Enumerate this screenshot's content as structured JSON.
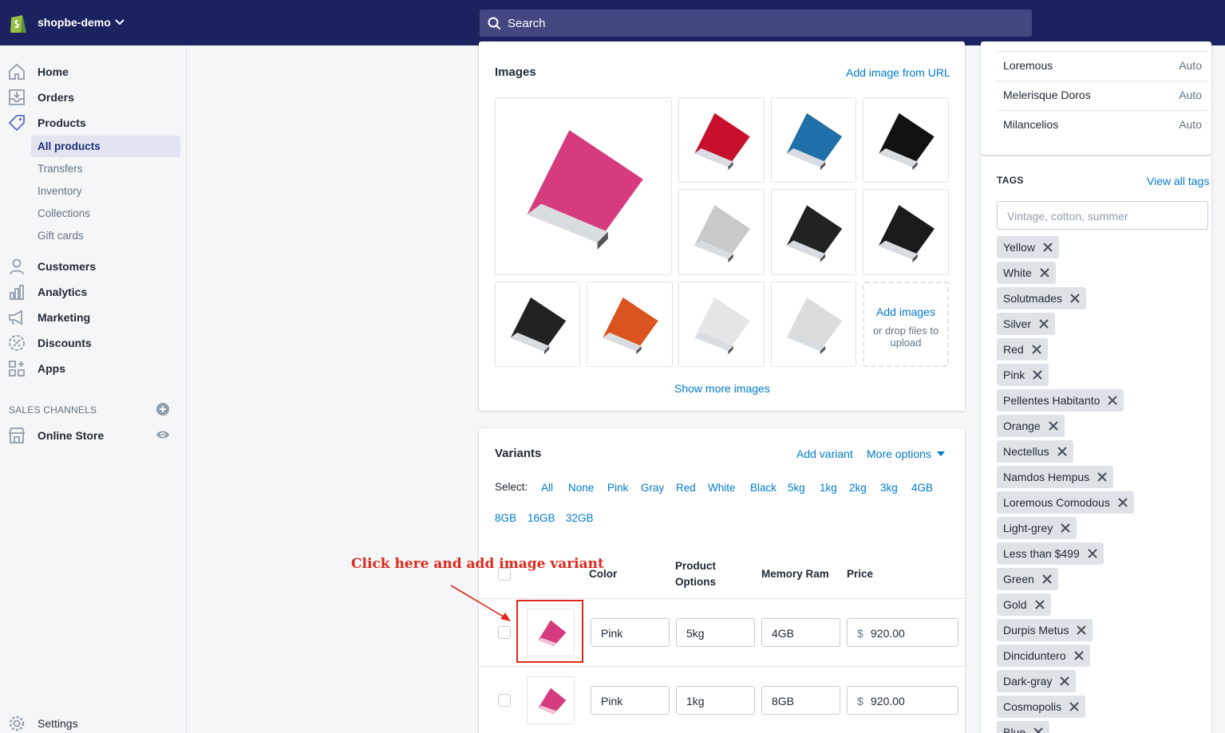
{
  "topbar": {
    "store_name": "shopbe-demo",
    "search_placeholder": "Search"
  },
  "sidebar": {
    "nav": [
      {
        "label": "Home",
        "icon": "home-icon"
      },
      {
        "label": "Orders",
        "icon": "orders-icon"
      },
      {
        "label": "Products",
        "icon": "tag-icon"
      }
    ],
    "products_sub": [
      "All products",
      "Transfers",
      "Inventory",
      "Collections",
      "Gift cards"
    ],
    "nav2": [
      {
        "label": "Customers",
        "icon": "person-icon"
      },
      {
        "label": "Analytics",
        "icon": "bar-chart-icon"
      },
      {
        "label": "Marketing",
        "icon": "megaphone-icon"
      },
      {
        "label": "Discounts",
        "icon": "discount-icon"
      },
      {
        "label": "Apps",
        "icon": "apps-icon"
      }
    ],
    "sales_channels_title": "SALES CHANNELS",
    "online_store": "Online Store",
    "settings": "Settings"
  },
  "images_card": {
    "title": "Images",
    "add_from_url": "Add image from URL",
    "add_images": "Add images",
    "drop_hint": "or drop files to upload",
    "show_more": "Show more images",
    "image_colors": [
      "#d63c7d",
      "#c8102e",
      "#1f6fa8",
      "#111111",
      "#c9c9c9",
      "#222222",
      "#1a1a1a",
      "#222222",
      "#d9541e",
      "#e6e6e6",
      "#dcdcdc"
    ]
  },
  "variants_card": {
    "title": "Variants",
    "add_variant": "Add variant",
    "more_options": "More options",
    "select_label": "Select:",
    "select_options_row1": [
      "All",
      "None",
      "Pink",
      "Gray",
      "Red",
      "White",
      "Black",
      "5kg",
      "1kg",
      "2kg",
      "3kg",
      "4GB"
    ],
    "select_options_row2": [
      "8GB",
      "16GB",
      "32GB"
    ],
    "headers": {
      "color": "Color",
      "product_options_1": "Product",
      "product_options_2": "Options",
      "memory": "Memory Ram",
      "price": "Price"
    },
    "rows": [
      {
        "color": "Pink",
        "option": "5kg",
        "memory": "4GB",
        "currency": "$",
        "price": "920.00"
      },
      {
        "color": "Pink",
        "option": "1kg",
        "memory": "8GB",
        "currency": "$",
        "price": "920.00"
      }
    ],
    "annotation": "Click here and add image variant"
  },
  "locations": [
    {
      "name": "Loremous",
      "value": "Auto"
    },
    {
      "name": "Melerisque Doros",
      "value": "Auto"
    },
    {
      "name": "Milancelios",
      "value": "Auto"
    }
  ],
  "tags": {
    "title": "TAGS",
    "view_all": "View all tags",
    "placeholder": "Vintage, cotton, summer",
    "items": [
      "Yellow",
      "White",
      "Solutmades",
      "Silver",
      "Red",
      "Pink",
      "Pellentes Habitanto",
      "Orange",
      "Nectellus",
      "Namdos Hempus",
      "Loremous Comodous",
      "Light-grey",
      "Less than $499",
      "Green",
      "Gold",
      "Durpis Metus",
      "Dinciduntero",
      "Dark-gray",
      "Cosmopolis",
      "Blue"
    ]
  },
  "colors": {
    "topbar": "#1c2260",
    "link": "#007ace",
    "annotation": "#e0271b"
  }
}
